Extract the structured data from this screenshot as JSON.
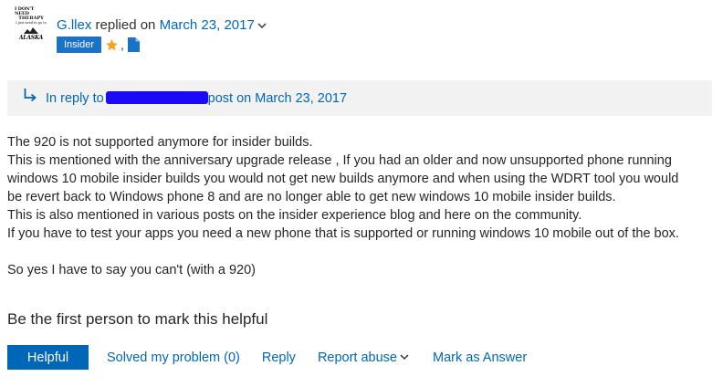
{
  "avatar": {
    "line1": "I DON'T NEED",
    "line2": "THERAPY",
    "line3": "I just need to go to",
    "line4": "ALASKA"
  },
  "post": {
    "author": "G.llex",
    "action": "replied on",
    "date": "March 23, 2017",
    "badge": "Insider",
    "badge_separator": ","
  },
  "reply_context": {
    "prefix": "In reply to",
    "suffix": "post on March 23, 2017"
  },
  "body": {
    "lines": [
      "The 920 is not supported anymore for insider builds.",
      "This is mentioned with the anniversary upgrade release , If you had an older and now unsupported phone running",
      "windows 10 mobile insider builds you would not get new builds anymore and when using the WDRT tool you would",
      "be revert back to Windows phone 8 and are no longer able to get new windows 10 mobile insider builds.",
      "This is also mentioned in various posts on the insider experience blog and here on the community.",
      "If you have to test your apps you need a new phone that is supported or running windows 10 mobile out of the box."
    ],
    "closing": "So yes I have to say you can't (with a 920)"
  },
  "helpful_prompt": "Be the first person to mark this helpful",
  "actions": {
    "helpful": "Helpful",
    "solved": "Solved my problem (0)",
    "reply": "Reply",
    "report": "Report abuse",
    "mark_answer": "Mark as Answer"
  },
  "colors": {
    "link": "#0067b8",
    "badge": "#1a73c8",
    "star": "#f7a21b",
    "redaction": "#1a0af5",
    "reply_box_bg": "#f2f2f2"
  }
}
